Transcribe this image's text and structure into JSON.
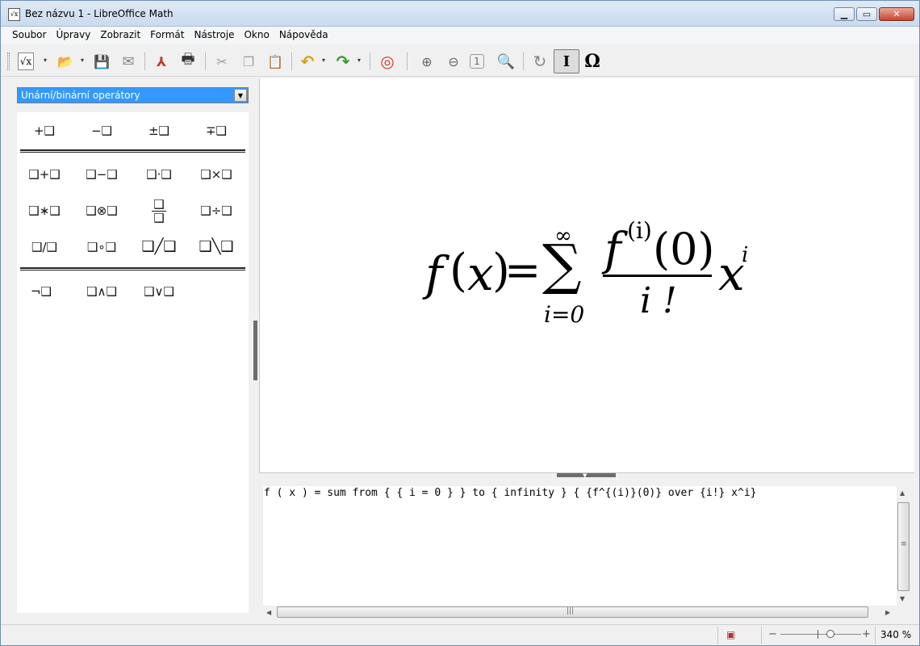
{
  "window": {
    "title": "Bez názvu 1 - LibreOffice Math",
    "app_icon": "√x",
    "minimize": "▁",
    "maximize": "▭",
    "close": "✕"
  },
  "menu": [
    "Soubor",
    "Úpravy",
    "Zobrazit",
    "Formát",
    "Nástroje",
    "Okno",
    "Nápověda"
  ],
  "toolbar": {
    "items": [
      {
        "name": "new-document-icon",
        "glyph": "√x"
      },
      {
        "name": "open-folder-icon",
        "glyph": "📂"
      },
      {
        "name": "save-icon",
        "glyph": "💾"
      },
      {
        "name": "email-icon",
        "glyph": "✉"
      },
      {
        "name": "export-pdf-icon",
        "glyph": "⅄"
      },
      {
        "name": "print-icon",
        "glyph": "🖶"
      },
      {
        "name": "cut-icon",
        "glyph": "✂"
      },
      {
        "name": "copy-icon",
        "glyph": "❐"
      },
      {
        "name": "paste-icon",
        "glyph": "📋"
      },
      {
        "name": "undo-icon",
        "glyph": "↶"
      },
      {
        "name": "redo-icon",
        "glyph": "↷"
      },
      {
        "name": "help-icon",
        "glyph": "◎"
      },
      {
        "name": "zoom-in-icon",
        "glyph": "⊕"
      },
      {
        "name": "zoom-out-icon",
        "glyph": "⊖"
      },
      {
        "name": "zoom-100-icon",
        "glyph": "1"
      },
      {
        "name": "show-all-icon",
        "glyph": "🔍"
      },
      {
        "name": "update-icon",
        "glyph": "↻"
      },
      {
        "name": "formula-cursor-icon",
        "glyph": "I"
      },
      {
        "name": "symbols-icon",
        "glyph": "Ω"
      }
    ],
    "dropdown_arrow": "▾"
  },
  "elements_panel": {
    "category": "Unární/binární operátory",
    "arrow": "▼",
    "rows": [
      [
        "+❑",
        "−❑",
        "±❑",
        "∓❑"
      ],
      [
        "❑+❑",
        "❑−❑",
        "❑·❑",
        "❑×❑"
      ],
      [
        "❑∗❑",
        "❑⊗❑",
        "❑/❑ frac",
        "❑÷❑"
      ],
      [
        "❑/❑",
        "❑∘❑",
        "❑╱❑",
        "❑╲❑"
      ],
      [
        "¬❑",
        "❑∧❑",
        "❑∨❑"
      ]
    ],
    "frac_top": "❑",
    "frac_bottom": "❑"
  },
  "formula_render": {
    "f": "f",
    "lparen": "(",
    "x": "x",
    "rparen": ")",
    "equals": "=",
    "sum": "∑",
    "infinity": "∞",
    "lower_limit": "i=0",
    "num_f": "f",
    "num_sup": "(i)",
    "num_arg": "(0)",
    "den": "i !",
    "x2": "x",
    "exp": "i"
  },
  "editor": {
    "text": "f ( x ) = sum from { { i = 0 } } to { infinity } { {f^{(i)}(0)} over {i!} x^i}"
  },
  "scroll": {
    "v_grip": "≡",
    "h_grip": "|||",
    "left": "◀",
    "right": "▶",
    "up": "▲",
    "down": "▼"
  },
  "statusbar": {
    "modified_icon": "▣",
    "zoom_minus": "−",
    "zoom_plus": "+",
    "zoom_level": "340 %"
  }
}
